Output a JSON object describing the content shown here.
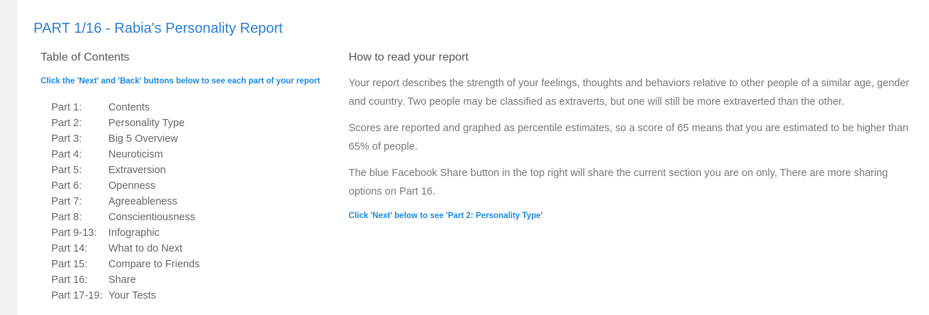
{
  "title": "PART 1/16 - Rabia's Personality Report",
  "toc": {
    "heading": "Table of Contents",
    "hint": "Click the 'Next' and 'Back' buttons below to see each part of your report",
    "items": [
      {
        "part": "Part 1:",
        "label": "Contents"
      },
      {
        "part": "Part 2:",
        "label": "Personality Type"
      },
      {
        "part": "Part 3:",
        "label": "Big 5 Overview"
      },
      {
        "part": "Part 4:",
        "label": "Neuroticism"
      },
      {
        "part": "Part 5:",
        "label": "Extraversion"
      },
      {
        "part": "Part 6:",
        "label": "Openness"
      },
      {
        "part": "Part 7:",
        "label": "Agreeableness"
      },
      {
        "part": "Part 8:",
        "label": "Conscientiousness"
      },
      {
        "part": "Part 9-13:",
        "label": "Infographic"
      },
      {
        "part": "Part 14:",
        "label": "What to do Next"
      },
      {
        "part": "Part 15:",
        "label": "Compare to Friends"
      },
      {
        "part": "Part 16:",
        "label": "Share"
      },
      {
        "part": "Part 17-19:",
        "label": "Your Tests"
      }
    ]
  },
  "read": {
    "heading": "How to read your report",
    "paragraphs": [
      "Your report describes the strength of your feelings, thoughts and behaviors relative to other people of a similar age, gender and country. Two people may be classified as extraverts, but one will still be more extraverted than the other.",
      "Scores are reported and graphed as percentile estimates, so a score of 65 means that you are estimated to be higher than 65% of people.",
      "The blue Facebook Share button in the top right will share the current section you are on only, There are more sharing options on Part 16."
    ],
    "next_hint": "Click 'Next' below to see 'Part 2: Personality Type'"
  }
}
